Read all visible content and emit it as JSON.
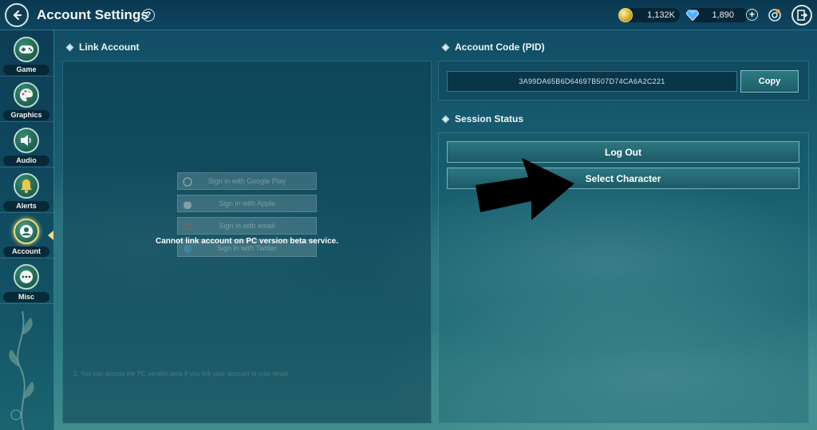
{
  "header": {
    "title": "Account Settings",
    "help_label": "?",
    "gold_amount": "1,132K",
    "gem_amount": "1,890",
    "plus_label": "+"
  },
  "sidebar": {
    "items": [
      {
        "label": "Game",
        "icon": "gamepad-icon"
      },
      {
        "label": "Graphics",
        "icon": "palette-icon"
      },
      {
        "label": "Audio",
        "icon": "speaker-icon"
      },
      {
        "label": "Alerts",
        "icon": "bell-icon"
      },
      {
        "label": "Account",
        "icon": "user-icon",
        "active": true
      },
      {
        "label": "Misc",
        "icon": "ellipsis-icon"
      }
    ]
  },
  "link_account": {
    "title": "Link Account",
    "buttons": [
      {
        "label": "Sign in with Google Play",
        "icon": "google-icon"
      },
      {
        "label": "Sign in with Apple",
        "icon": "apple-icon"
      },
      {
        "label": "Sign in with email",
        "icon": "mail-icon"
      },
      {
        "label": "Sign in with Twitter",
        "icon": "twitter-icon"
      }
    ],
    "message": "Cannot link account on PC version beta service.",
    "note": "1. You can access the PC version beta if you link your account to your email."
  },
  "account_code": {
    "title": "Account Code (PID)",
    "pid": "3A99DA65B6D64697B507D74CA6A2C221",
    "copy_label": "Copy"
  },
  "session_status": {
    "title": "Session Status",
    "logout_label": "Log Out",
    "select_character_label": "Select Character"
  },
  "colors": {
    "accent_gold": "#f1dc7a",
    "panel_border": "#2e7a93",
    "button_top": "#2d7780"
  }
}
